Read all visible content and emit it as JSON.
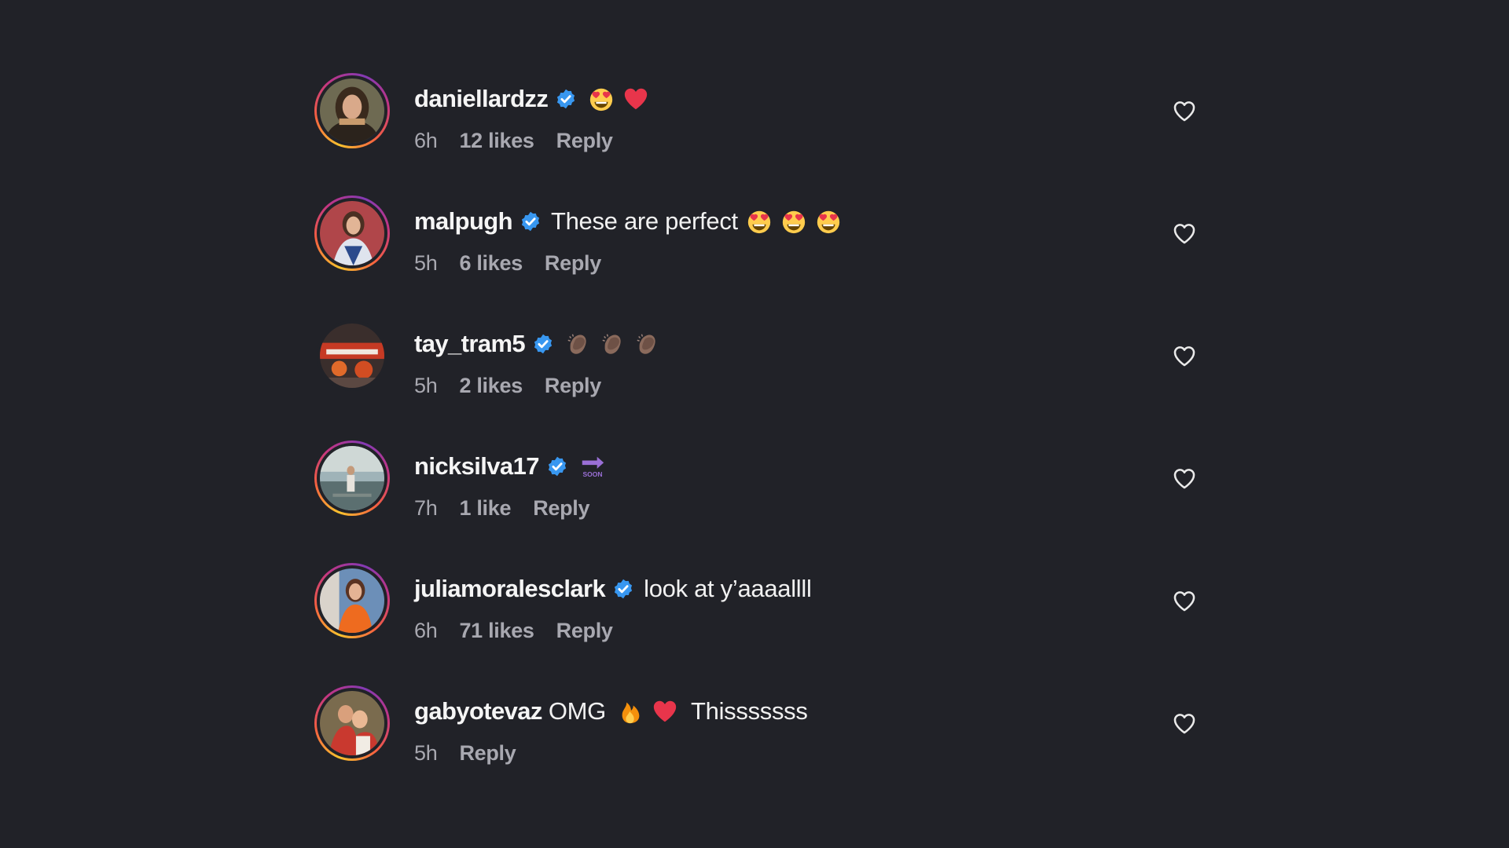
{
  "colors": {
    "background": "#212228",
    "text": "#f5f5f5",
    "muted": "#a8a8b0",
    "verified": "#3897f0"
  },
  "comments": [
    {
      "username": "daniellardzz",
      "verified": true,
      "text_before": "",
      "emojis": [
        "heart-eyes-emoji",
        "red-heart-emoji"
      ],
      "text_after": "",
      "time": "6h",
      "likes": "12 likes",
      "reply": "Reply",
      "story_ring": true
    },
    {
      "username": "malpugh",
      "verified": true,
      "text_before": "These are perfect",
      "emojis": [
        "heart-eyes-emoji",
        "heart-eyes-emoji",
        "heart-eyes-emoji"
      ],
      "text_after": "",
      "time": "5h",
      "likes": "6 likes",
      "reply": "Reply",
      "story_ring": true
    },
    {
      "username": "tay_tram5",
      "verified": true,
      "text_before": "",
      "emojis": [
        "clapping-hands-emoji",
        "clapping-hands-emoji",
        "clapping-hands-emoji"
      ],
      "text_after": "",
      "time": "5h",
      "likes": "2 likes",
      "reply": "Reply",
      "story_ring": false
    },
    {
      "username": "nicksilva17",
      "verified": true,
      "text_before": "",
      "emojis": [
        "soon-arrow-emoji"
      ],
      "text_after": "",
      "time": "7h",
      "likes": "1 like",
      "reply": "Reply",
      "story_ring": true
    },
    {
      "username": "juliamoralesclark",
      "verified": true,
      "text_before": "look at y’aaaallll",
      "emojis": [],
      "text_after": "",
      "time": "6h",
      "likes": "71 likes",
      "reply": "Reply",
      "story_ring": true
    },
    {
      "username": "gabyotevaz",
      "verified": false,
      "text_before": "OMG",
      "emojis": [
        "fire-emoji",
        "red-heart-emoji"
      ],
      "text_after": "Thisssssss",
      "time": "5h",
      "likes": "",
      "reply": "Reply",
      "story_ring": true
    }
  ]
}
